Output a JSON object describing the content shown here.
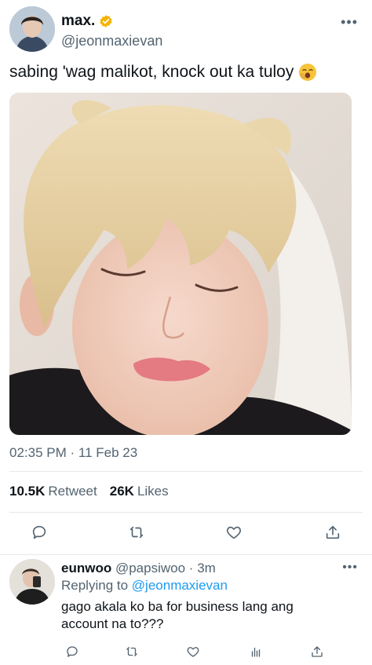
{
  "tweet": {
    "display_name": "max.",
    "handle": "@jeonmaxievan",
    "verified_icon": "verified-badge-icon",
    "text": "sabing 'wag malikot, knock out ka tuloy",
    "emoji": "yawning-face-emoji",
    "media_alt": "photo-of-sleeping-person",
    "timestamp": "02:35 PM · 11 Feb 23",
    "retweets": "10.5K",
    "retweet_label": "Retweet",
    "likes": "26K",
    "likes_label": "Likes",
    "more": "•••"
  },
  "actions": [
    "reply-icon",
    "retweet-icon",
    "like-icon",
    "share-icon"
  ],
  "reply": {
    "display_name": "eunwoo",
    "handle": "@papsiwoo",
    "time": "3m",
    "replying_prefix": "Replying to",
    "replying_to": "@jeonmaxievan",
    "text": "gago akala ko ba for business lang ang account na to???",
    "more": "•••",
    "actions": [
      "reply-icon",
      "retweet-icon",
      "like-icon",
      "analytics-icon",
      "share-icon"
    ]
  },
  "colors": {
    "accent": "#1d9bf0",
    "verified": "#f4b400",
    "secondary_text": "#536471",
    "primary_text": "#0f1419",
    "divider": "#e5e8eb"
  }
}
